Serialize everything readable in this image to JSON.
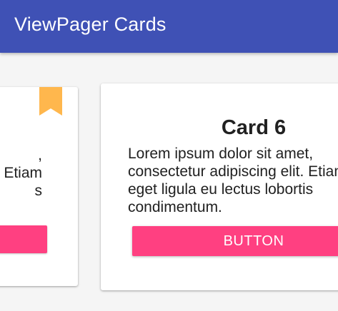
{
  "app_bar": {
    "title": "ViewPager Cards",
    "color": "#3f51b5"
  },
  "pager": {
    "previous_card": {
      "bookmark_icon": "bookmark-icon",
      "bookmark_color": "#ffb74d",
      "visible_lines": [
        ",",
        "Etiam",
        "s"
      ],
      "button_color": "#ff4081"
    },
    "current_card": {
      "title": "Card 6",
      "body_lines": [
        "Lorem ipsum dolor sit amet,",
        "consectetur adipiscing elit. Etiam",
        "eget ligula eu lectus lobortis",
        "condimentum."
      ],
      "button_label": "BUTTON",
      "button_color": "#ff4081"
    }
  }
}
